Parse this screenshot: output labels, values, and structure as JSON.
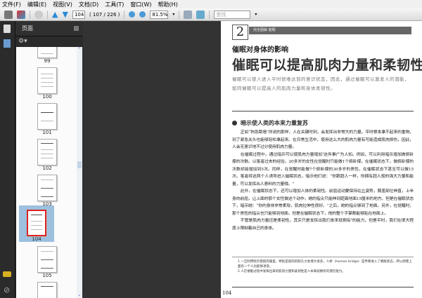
{
  "menu": [
    "文件(F)",
    "编辑(E)",
    "视图(V)",
    "文档(D)",
    "工具(T)",
    "窗口(W)",
    "帮助(H)"
  ],
  "toolbar": {
    "page_input": "104",
    "page_count": "( 107 / 226 )",
    "zoom": "81.5%",
    "search_placeholder": "查找"
  },
  "panel": {
    "title": "页面",
    "thumbnails": [
      "99",
      "100",
      "101",
      "102",
      "103",
      "104",
      "105"
    ],
    "selected": "104"
  },
  "page": {
    "chapter_number": "2",
    "band_text": "完全图解  催眠",
    "subtitle": "催眠对身体的影响",
    "title": "催眠可以提高肌肉力量和柔韧性",
    "intro": "催眠可以使人进入平时很难达到的意识状态，因此，通过催眠可以激发人的潜能，如同催眠可以提高人的肌肉力量和身体柔韧性。",
    "section_heading": "暗示使人类的本来力量复苏",
    "paragraphs": [
      "正如“狗急跳墙”所说的那样，人在关键时刻，会发挥出非常大的力量。平时根本拿不起来的重物，到了紧急关头也能够轻松拿起来。在日常生活中，使用这么大的肌肉力量有可能造成肌肉损伤，因此，人会无意识地不过分使用肌肉力量。",
      "在催眠过程中，通过暗示可以使肌肉力量增加¹这件事广为人知。例如，可以利用暗示增加做俯卧撑的次数。以笔者过去的经验，20多岁的女性在觉醒时只能做1个俯卧撑，在催眠状态下，做俯卧撑的次数却能增加到5次。同样，在觉醒时能做7个俯卧撑的30多岁的男性，在催眠状态下甚至可以做15次。笔者将这两个人诱导进入催眠状态，暗示他们说：“你跟超人一样，你拥有超人般的强大力量和能量，可以发挥出人意料的力量哦。”",
      "此外，在催眠状态下，还可以增加人体的柔韧性。前屈运动要保持站立姿势，膝盖部位伸直，上半身向前屈，让上面的那个女性做这个动作，她的指尖只能伸到距离地面15厘米的地方。但是在催眠状态下，暗示她：“你的身体非常柔软，肌肉拉伸性很好。”之后，她的指尖够到了地面。另外，在觉醒时，那个男性的指尖也只能够到地面，但是在催眠状态下，他的整个手掌都能够贴在地面上。",
      "不管是肌肉力量还是柔韧性，其实只是发挥出我们本来就拥有²的能力，但是平时，我们在很大程度上限制着自己的身体。"
    ],
    "footnotes": [
      "1 一旦利用暗示使肌肉僵直，特别是肌肉的耐久力会增大很多，人桥（Human bridge）是界尊进入了催眠状态，所以即使上面有一个人也能够承受。",
      "2 人在催眠过程中发挥出来的肌肉力量和柔韧性是人本来就拥有的潜在能力。"
    ],
    "page_number": "104"
  }
}
